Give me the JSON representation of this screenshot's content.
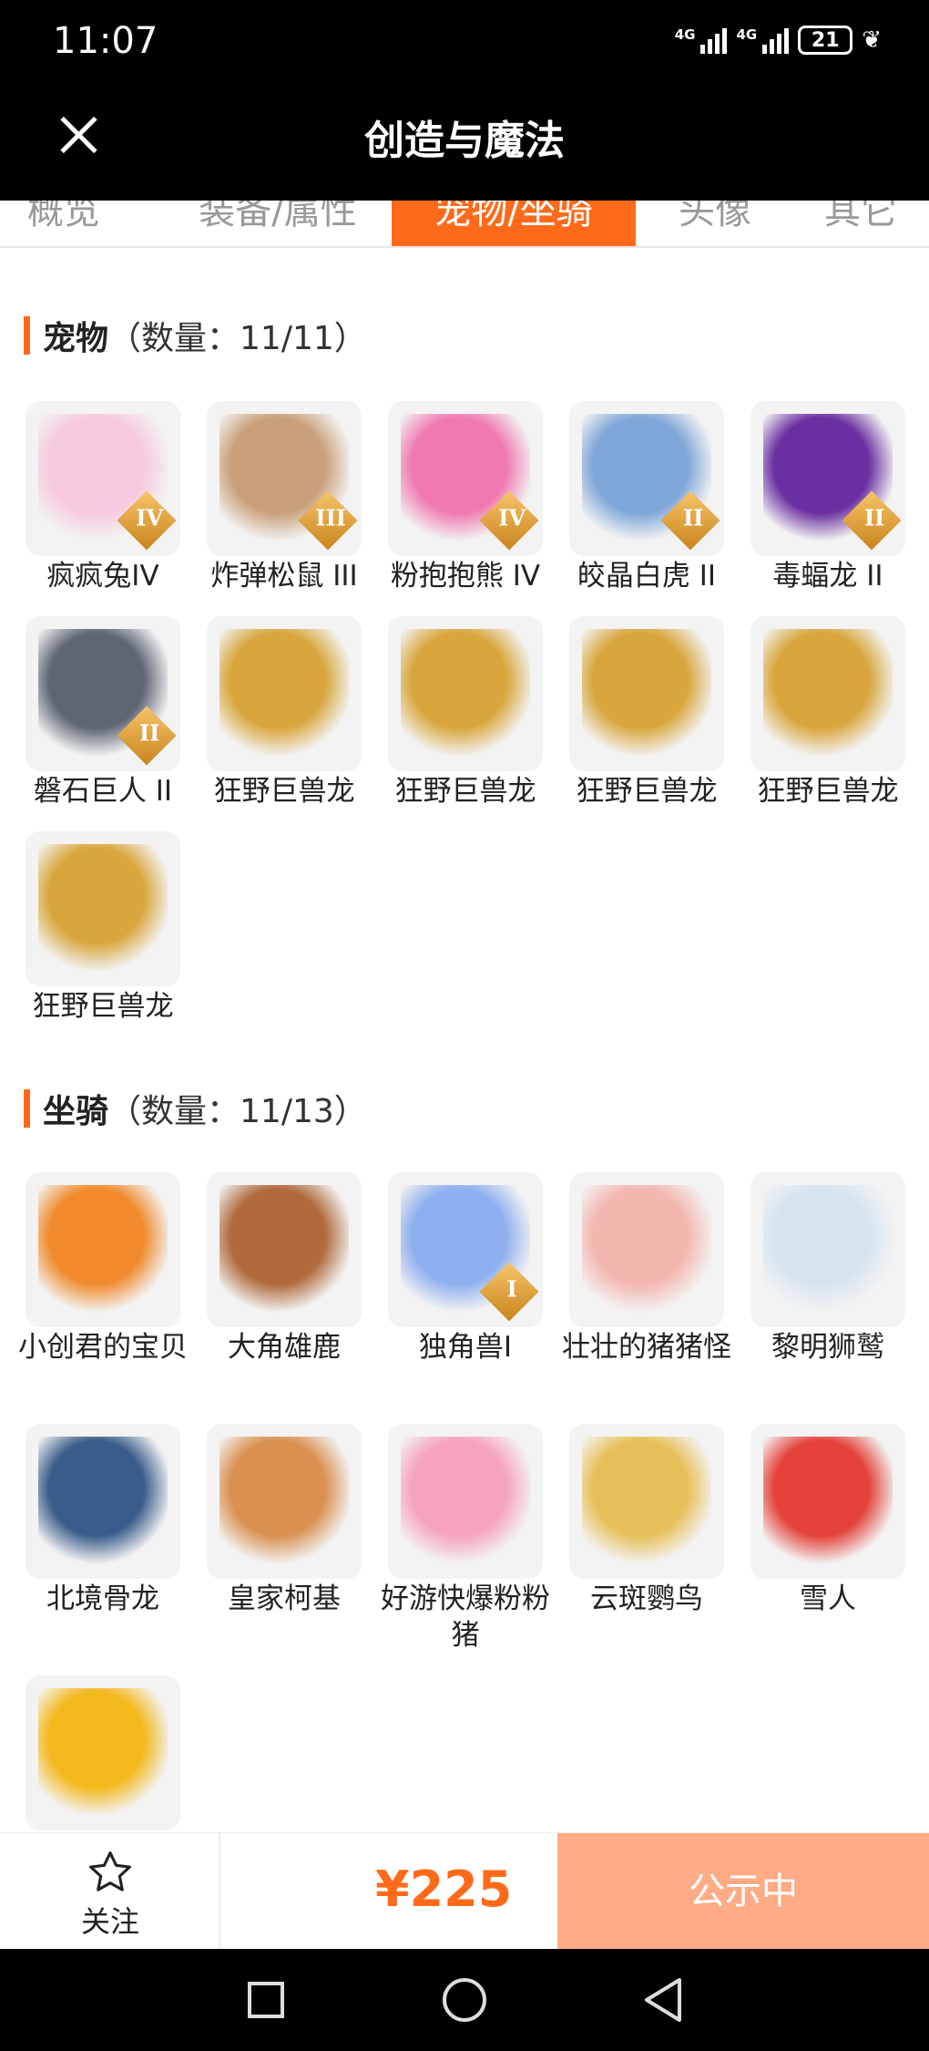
{
  "status": {
    "time": "11:07",
    "battery": "21",
    "network_1": "4G",
    "network_2": "4G"
  },
  "header": {
    "title": "创造与魔法"
  },
  "tabs": [
    {
      "label": "概览"
    },
    {
      "label": "装备/属性"
    },
    {
      "label": "宠物/坐骑",
      "active": true
    },
    {
      "label": "头像"
    },
    {
      "label": "其它"
    }
  ],
  "pets": {
    "title": "宠物",
    "count": "（数量：11/11）",
    "items": [
      {
        "label": "疯疯兔IV",
        "rank": "IV",
        "icon": "rabbit-icon",
        "color": "#f6c9de"
      },
      {
        "label": "炸弹松鼠 III",
        "rank": "III",
        "icon": "squirrel-icon",
        "color": "#c9a07a"
      },
      {
        "label": "粉抱抱熊 IV",
        "rank": "IV",
        "icon": "bear-icon",
        "color": "#f07ab0"
      },
      {
        "label": "皎晶白虎 II",
        "rank": "II",
        "icon": "tiger-icon",
        "color": "#7fa6d8"
      },
      {
        "label": "毒蝠龙 II",
        "rank": "II",
        "icon": "bat-dragon-icon",
        "color": "#6a2fa0"
      },
      {
        "label": "磐石巨人 II",
        "rank": "II",
        "icon": "golem-icon",
        "color": "#5e6674"
      },
      {
        "label": "狂野巨兽龙",
        "icon": "dragon-icon",
        "color": "#d8a63c"
      },
      {
        "label": "狂野巨兽龙",
        "icon": "dragon-icon",
        "color": "#d8a63c"
      },
      {
        "label": "狂野巨兽龙",
        "icon": "dragon-icon",
        "color": "#d8a63c"
      },
      {
        "label": "狂野巨兽龙",
        "icon": "dragon-icon",
        "color": "#d8a63c"
      },
      {
        "label": "狂野巨兽龙",
        "icon": "dragon-icon",
        "color": "#d8a63c"
      }
    ]
  },
  "mounts": {
    "title": "坐骑",
    "count": "（数量：11/13）",
    "items": [
      {
        "label": "小创君的宝贝",
        "icon": "phoenix-icon",
        "color": "#f08a2c"
      },
      {
        "label": "大角雄鹿",
        "icon": "deer-icon",
        "color": "#b06a3c"
      },
      {
        "label": "独角兽I",
        "rank": "I",
        "icon": "unicorn-icon",
        "color": "#8fb0ee"
      },
      {
        "label": "壮壮的猪猪怪",
        "icon": "pig-icon",
        "color": "#f3b7b0"
      },
      {
        "label": "黎明狮鹫",
        "icon": "griffin-icon",
        "color": "#d6e4f0"
      },
      {
        "label": "北境骨龙",
        "icon": "bone-dragon-icon",
        "color": "#3a5c8a"
      },
      {
        "label": "皇家柯基",
        "icon": "corgi-icon",
        "color": "#d99050"
      },
      {
        "label": "好游快爆粉粉猪",
        "icon": "pink-pig-icon",
        "color": "#f6a3c0"
      },
      {
        "label": "云斑鹦鸟",
        "icon": "parrot-icon",
        "color": "#e8c05a"
      },
      {
        "label": "雪人",
        "icon": "snowman-icon",
        "color": "#e4423a"
      },
      {
        "label": "",
        "icon": "golden-pig-icon",
        "color": "#f3b81c"
      }
    ]
  },
  "bottom_bar": {
    "follow_label": "关注",
    "price": "¥225",
    "action_label": "公示中"
  }
}
